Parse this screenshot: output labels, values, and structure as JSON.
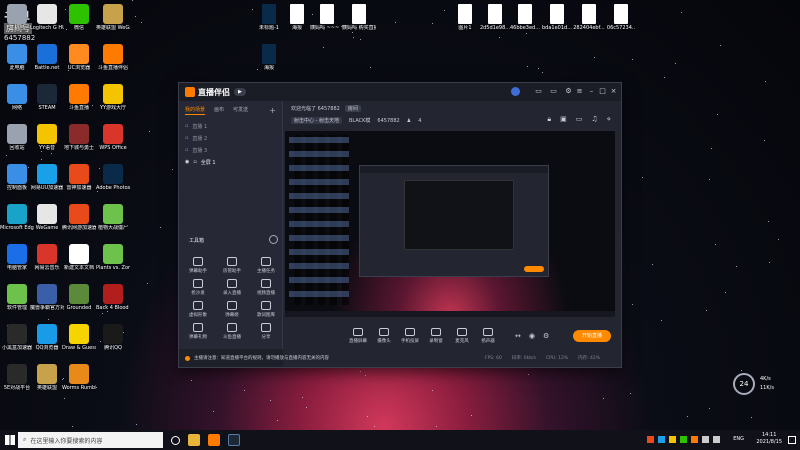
{
  "watermark": {
    "line1": "斗鱼",
    "line2": "房间号",
    "line3": "6457882"
  },
  "desktop_icons": [
    {
      "label": "主机号",
      "color": "#9aa2b0"
    },
    {
      "label": "Logitech G HUB",
      "color": "#e6e6e6"
    },
    {
      "label": "微信",
      "color": "#2dc100"
    },
    {
      "label": "英雄联盟 WeGame版",
      "color": "#c8a24a"
    },
    {
      "label": "此电脑",
      "color": "#3a8ee6"
    },
    {
      "label": "Battle.net",
      "color": "#1b6fd8"
    },
    {
      "label": "UC浏览器",
      "color": "#ff8a1f"
    },
    {
      "label": "斗鱼直播伴侣",
      "color": "#ff7a00"
    },
    {
      "label": "网络",
      "color": "#3a8ee6"
    },
    {
      "label": "STEAM",
      "color": "#1b2838"
    },
    {
      "label": "斗鱼直播",
      "color": "#ff7a00"
    },
    {
      "label": "YY游戏大厅",
      "color": "#f5c400"
    },
    {
      "label": "回收站",
      "color": "#9aa2b0"
    },
    {
      "label": "YY语音",
      "color": "#f5c400"
    },
    {
      "label": "地下城与勇士",
      "color": "#8a2a2a"
    },
    {
      "label": "WPS Office",
      "color": "#d9352b"
    },
    {
      "label": "控制面板",
      "color": "#3a8ee6"
    },
    {
      "label": "网易UU加速器",
      "color": "#1aa0e8"
    },
    {
      "label": "雷神加速器",
      "color": "#e84a1a"
    },
    {
      "label": "Adobe Photosho...",
      "color": "#0a2a4a"
    },
    {
      "label": "Microsoft Edge",
      "color": "#1aa3c9"
    },
    {
      "label": "WeGame",
      "color": "#e6e6e6"
    },
    {
      "label": "腾讯网游加速器",
      "color": "#e84a1a"
    },
    {
      "label": "植物大战僵尸",
      "color": "#6cc24a"
    },
    {
      "label": "电脑管家",
      "color": "#1a6fe8"
    },
    {
      "label": "网易云音乐",
      "color": "#d9352b"
    },
    {
      "label": "新建文本文档",
      "color": "#ffffff"
    },
    {
      "label": "Plants vs. Zombies G...",
      "color": "#6cc24a"
    },
    {
      "label": "软件管理",
      "color": "#6cc24a"
    },
    {
      "label": "魔兽争霸官方对战平台",
      "color": "#3a5ea8"
    },
    {
      "label": "Grounded",
      "color": "#5a8a3a"
    },
    {
      "label": "Back 4 Blood Beta",
      "color": "#b21e1e"
    },
    {
      "label": "小黑盒加速器",
      "color": "#2a2a2a"
    },
    {
      "label": "QQ浏览器",
      "color": "#1a9be8"
    },
    {
      "label": "Draw & Guess",
      "color": "#f5d400"
    },
    {
      "label": "腾讯QQ",
      "color": "#1a1a1a"
    },
    {
      "label": "5E对战平台",
      "color": "#2a2a2a"
    },
    {
      "label": "英雄联盟",
      "color": "#c8a24a"
    },
    {
      "label": "Worms Rumble",
      "color": "#e88a1a"
    }
  ],
  "top_icons": [
    {
      "label": "未标题-1",
      "color": "#0a2a4a"
    },
    {
      "label": "海报",
      "color": "#ffffff"
    },
    {
      "label": "姨妈吗 ~~~ 个人购买(1)",
      "color": "#ffffff"
    },
    {
      "label": "姨妈吗 购买直播间",
      "color": "#ffffff"
    },
    {
      "label": "海报",
      "color": "#0a2a4a"
    },
    {
      "label": "图片1",
      "color": "#ffffff"
    },
    {
      "label": "2d5d1e98...",
      "color": "#ffffff"
    },
    {
      "label": "46bbe3ed...",
      "color": "#ffffff"
    },
    {
      "label": "bda1e01d...",
      "color": "#ffffff"
    },
    {
      "label": "282404ebf...",
      "color": "#ffffff"
    },
    {
      "label": "06c57234..",
      "color": "#ffffff"
    }
  ],
  "app": {
    "title": "直播伴侣",
    "version": "▶",
    "tabs": [
      "我的场景",
      "画布",
      "可发送"
    ],
    "scenes": [
      "直播 1",
      "直播 2",
      "直播 3",
      "全屏 1"
    ],
    "tools_title": "工具箱",
    "tools": [
      "弹幕助手",
      "房管助手",
      "主播任务",
      "抢沙发",
      "录入直播",
      "视频直播",
      "虚拟形象",
      "弹幕姬",
      "歌词图库",
      "弹幕礼物",
      "斗鱼直播",
      "分享"
    ],
    "room_notice": "欢迎光临了 6457882",
    "room_tag": "房间",
    "category": "射击中心 - 射击天地",
    "mode": "BLACK模",
    "room_id": "6457882",
    "count": "4",
    "controls": [
      "直播屏幕",
      "摄像头",
      "手机投屏",
      "录制窗",
      "麦克风",
      "扬声器"
    ],
    "start_button": "开始直播",
    "notice": "主播请注意：知道直播平台的规则，请勿播放与直播内容无关的内容",
    "status": [
      "FPS: 60",
      "码率: 0kb/s",
      "CPU: 12%",
      "内存: 42%"
    ]
  },
  "taskbar": {
    "search_placeholder": "在这里输入你要搜索的内容",
    "lang": "ENG",
    "time": "14:11",
    "date": "2021/8/15"
  },
  "widget": {
    "value": "24",
    "unit": "℃",
    "up": "4K/s",
    "down": "11K/s"
  }
}
